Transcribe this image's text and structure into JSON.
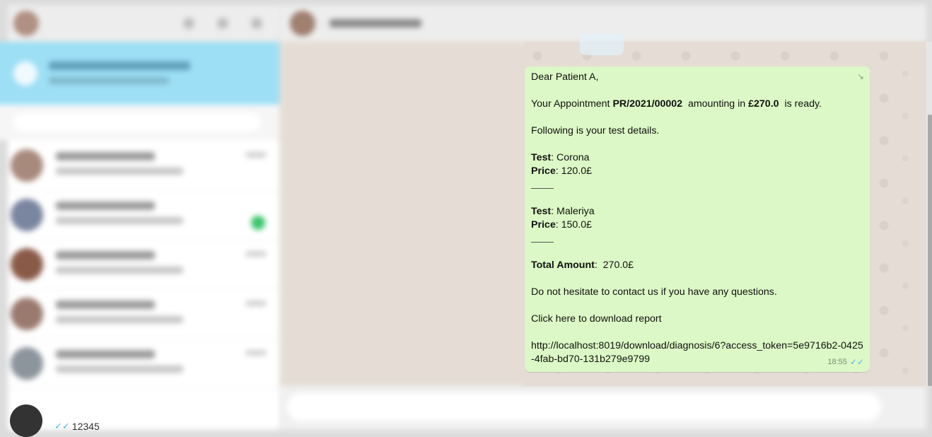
{
  "message": {
    "greeting": "Dear Patient A,",
    "appointment": {
      "prefix": "Your Appointment",
      "reference": "PR/2021/00002",
      "mid": "amounting in",
      "amount": "£270.0",
      "suffix": "is ready."
    },
    "intro": "Following is your test details.",
    "tests": [
      {
        "test_label": "Test",
        "test_name": ": Corona",
        "price_label": "Price",
        "price_value": ": 120.0£"
      },
      {
        "test_label": "Test",
        "test_name": ": Maleriya",
        "price_label": "Price",
        "price_value": ": 150.0£"
      }
    ],
    "total_label": "Total Amount",
    "total_value": ":  270.0£",
    "contact_note": "Do not hesitate to contact us if you have any questions.",
    "download_text": "Click here to download report",
    "download_url": "http://localhost:8019/download/diagnosis/6?access_token=5e9716b2-0425-4fab-bd70-131b279e9799",
    "time": "18:55",
    "status_icon": "double-check-icon"
  },
  "chat_list": {
    "last_preview_text": "12345",
    "last_preview_icon": "double-check-icon"
  },
  "colors": {
    "bubble_bg": "#dcf8c6",
    "chat_bg": "#e5ddd5",
    "read_ticks": "#4fb6ec",
    "notice_bar": "#9ddff5"
  }
}
